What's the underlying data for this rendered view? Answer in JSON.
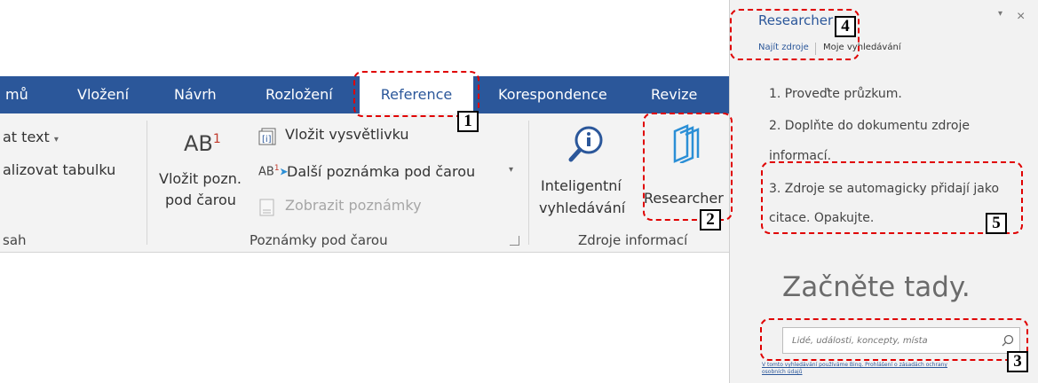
{
  "tabs": {
    "t0": "mů",
    "t1": "Vložení",
    "t2": "Návrh",
    "t3": "Rozložení",
    "t4": "Reference",
    "t5": "Korespondence",
    "t6": "Revize"
  },
  "ribbon": {
    "toc_group": {
      "add_text": "at text",
      "update_table": "alizovat tabulku",
      "label": "sah"
    },
    "footnotes_group": {
      "insert_footnote_line1": "Vložit pozn.",
      "insert_footnote_line2": "pod čarou",
      "insert_endnote": "Vložit vysvětlivku",
      "next_footnote": "Další poznámka pod čarou",
      "show_notes": "Zobrazit poznámky",
      "label": "Poznámky pod čarou"
    },
    "research_group": {
      "smart_lookup_line1": "Inteligentní",
      "smart_lookup_line2": "vyhledávání",
      "researcher": "Researcher",
      "label": "Zdroje informací"
    }
  },
  "researcher_pane": {
    "title": "Researcher",
    "nav_find": "Najít zdroje",
    "nav_my": "Moje vyhledávání",
    "steps": [
      "1. Proveďte průzkum.",
      "2. Doplňte do dokumentu zdroje",
      "informací.",
      "3. Zdroje se automagicky přidají jako",
      "citace. Opakujte."
    ],
    "start_heading": "Začněte tady.",
    "search_placeholder": "Lidé, události, koncepty, místa",
    "footer_line1": "V tomto vyhledávání používáme Bing. Prohlášení o zásadách ochrany",
    "footer_line2": "osobních údajů"
  },
  "callouts": {
    "c1": "1",
    "c2": "2",
    "c3": "3",
    "c4": "4",
    "c5": "5"
  },
  "colors": {
    "tabbar": "#2b579a",
    "researcher_icon": "#2b8fd6",
    "annotation": "#e00000"
  }
}
